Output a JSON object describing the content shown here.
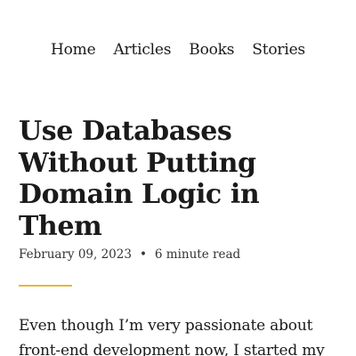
{
  "nav": {
    "items": [
      {
        "label": "Home"
      },
      {
        "label": "Articles"
      },
      {
        "label": "Books"
      },
      {
        "label": "Stories"
      }
    ]
  },
  "article": {
    "title": "Use Databases Without Putting Domain Logic in Them",
    "date": "February 09, 2023",
    "separator": "•",
    "read_time": "6 minute read",
    "body_excerpt": "Even though I’m very passionate about front-end development now, I started my"
  },
  "colors": {
    "accent_rule": "#e5b83d",
    "text": "#1a1a1a",
    "background": "#ffffff"
  }
}
